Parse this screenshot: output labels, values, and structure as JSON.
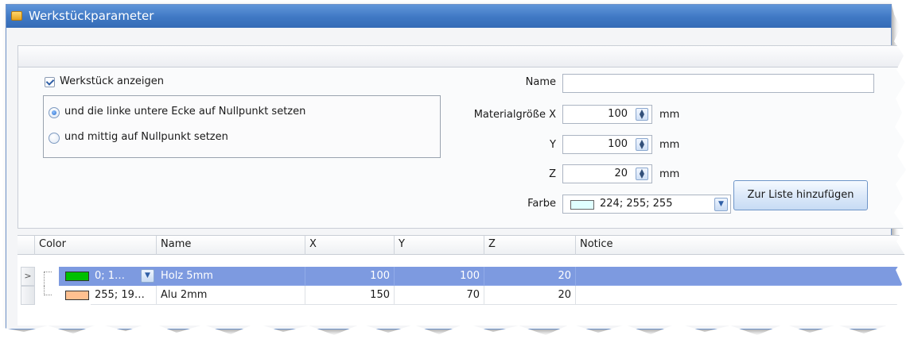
{
  "window": {
    "title": "Werkstückparameter"
  },
  "options": {
    "show_workpiece_label": "Werkstück anzeigen",
    "radio_corner_label": "und die linke untere Ecke auf Nullpunkt setzen",
    "radio_center_label": "und mittig auf Nullpunkt setzen",
    "selected_radio": "corner"
  },
  "form": {
    "name_label": "Name",
    "name_value": "",
    "size_x_label": "Materialgröße X",
    "size_x_value": "100",
    "size_y_label": "Y",
    "size_y_value": "100",
    "size_z_label": "Z",
    "size_z_value": "20",
    "unit": "mm",
    "color_label": "Farbe",
    "color_value": "224; 255; 255",
    "color_hex": "#e0ffff",
    "add_button": "Zur Liste hinzufügen"
  },
  "grid": {
    "columns": [
      "Color",
      "Name",
      "X",
      "Y",
      "Z",
      "Notice"
    ],
    "rows": [
      {
        "color_text": "0; 1…",
        "color_hex": "#00c000",
        "name": "Holz 5mm",
        "x": "100",
        "y": "100",
        "z": "20",
        "notice": "",
        "selected": true,
        "indicator": ">"
      },
      {
        "color_text": "255; 19…",
        "color_hex": "#ffc090",
        "name": "Alu 2mm",
        "x": "150",
        "y": "70",
        "z": "20",
        "notice": "",
        "selected": false,
        "indicator": ""
      }
    ]
  },
  "colors": {
    "titlebar": "#3f78c4",
    "selection": "#7d9ae0"
  }
}
